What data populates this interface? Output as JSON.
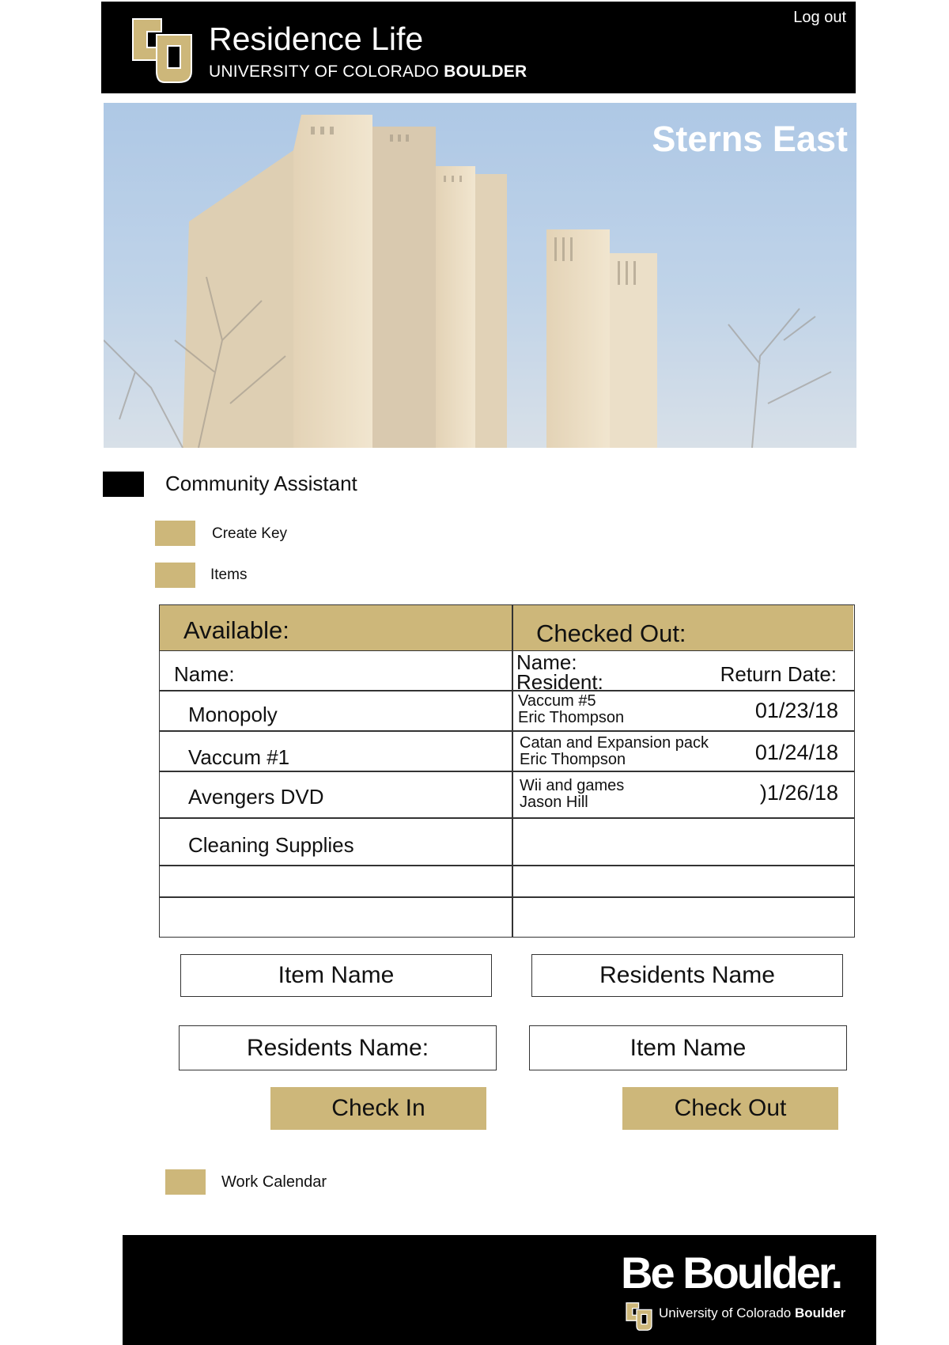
{
  "header": {
    "title": "Residence Life",
    "subtitle_prefix": "UNIVERSITY OF COLORADO",
    "subtitle_bold": "BOULDER",
    "logout_label": "Log out"
  },
  "hero": {
    "title": "Sterns East"
  },
  "nav": {
    "role_label": "Community Assistant",
    "create_key_label": "Create Key",
    "items_label": "Items",
    "calendar_label": "Work Calendar"
  },
  "table": {
    "available_header": "Available:",
    "checked_out_header": "Checked Out:",
    "available_name_col": "Name:",
    "co_name_col": "Name:",
    "co_resident_col": "Resident:",
    "co_date_col": "Return Date:",
    "available_items": [
      "Monopoly",
      "Vaccum #1",
      "Avengers DVD",
      "Cleaning Supplies"
    ],
    "checked_out": [
      {
        "item": "Vaccum #5",
        "resident": "Eric Thompson",
        "date": "01/23/18"
      },
      {
        "item": "Catan and Expansion pack",
        "resident": "Eric Thompson",
        "date": "01/24/18"
      },
      {
        "item": "Wii and games",
        "resident": "Jason Hill",
        "date": ")1/26/18"
      }
    ]
  },
  "checkin_form": {
    "item_placeholder": "Item Name",
    "resident_placeholder": "Residents Name:",
    "button_label": "Check In"
  },
  "checkout_form": {
    "resident_placeholder": "Residents Name",
    "item_placeholder": "Item Name",
    "button_label": "Check Out"
  },
  "footer": {
    "tagline": "Be Boulder.",
    "sub_prefix": "University of Colorado",
    "sub_bold": "Boulder"
  },
  "colors": {
    "gold": "#cdb77a",
    "black": "#000000",
    "sky": "#9dbadc"
  }
}
